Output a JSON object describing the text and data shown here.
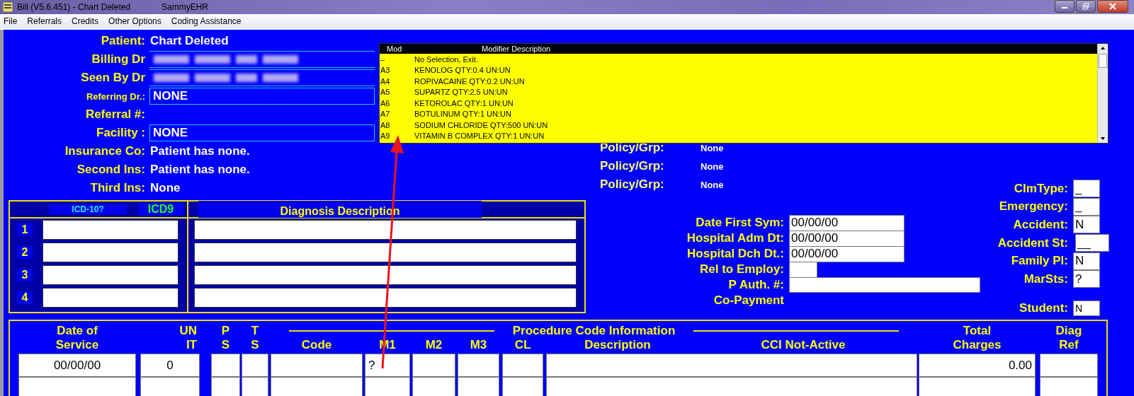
{
  "window": {
    "title": "Bill (V5.6.451) - Chart  Deleted",
    "app_name": "SammyEHR"
  },
  "menu": [
    "File",
    "Referrals",
    "Credits",
    "Other Options",
    "Coding Assistance"
  ],
  "patient_fields": [
    {
      "label": "Patient:",
      "kind": "text",
      "compact": false,
      "value": "Chart  Deleted"
    },
    {
      "label": "Billing Dr",
      "kind": "blurred",
      "compact": false
    },
    {
      "label": "Seen By Dr",
      "kind": "blurred",
      "compact": false
    },
    {
      "label": "Referring Dr.:",
      "kind": "field",
      "compact": true,
      "value": "NONE"
    },
    {
      "label": "Referral #:",
      "kind": "text",
      "compact": false
    },
    {
      "label": "Facility :",
      "kind": "field",
      "compact": false,
      "value": "NONE"
    },
    {
      "label": "Insurance Co:",
      "kind": "text",
      "compact": false,
      "value": "Patient has none."
    },
    {
      "label": "Second Ins:",
      "kind": "text",
      "compact": false,
      "value": "Patient has none."
    },
    {
      "label": "Third Ins:",
      "kind": "text",
      "compact": false,
      "value": "None"
    }
  ],
  "policies": [
    {
      "label": "Policy/Grp:",
      "value": "None"
    },
    {
      "label": "Policy/Grp:",
      "value": "None"
    },
    {
      "label": "Policy/Grp:",
      "value": "None"
    }
  ],
  "dates": [
    {
      "label": "Date First Sym:",
      "kind": "date",
      "value": "00/00/00"
    },
    {
      "label": "Hospital Adm Dt:",
      "kind": "date",
      "value": "00/00/00"
    },
    {
      "label": "Hospital Dch Dt.:",
      "kind": "date",
      "value": "00/00/00"
    },
    {
      "label": "Rel to Employ:",
      "kind": "short"
    },
    {
      "label": "P Auth. #:",
      "kind": "long"
    },
    {
      "label": "Co-Payment",
      "kind": "label"
    }
  ],
  "flags": [
    {
      "label": "ClmType:",
      "value": "_",
      "kind": "normal"
    },
    {
      "label": "Emergency:",
      "value": "_",
      "kind": "normal"
    },
    {
      "label": "Accident:",
      "value": "N",
      "kind": "normal"
    },
    {
      "label": "Accident St:",
      "value": "__",
      "kind": "wide"
    },
    {
      "label": "Family Pl:",
      "value": "N",
      "kind": "normal"
    },
    {
      "label": "MarSts:",
      "value": "?",
      "kind": "normal"
    }
  ],
  "student": {
    "label": "Student:",
    "value": "N"
  },
  "diagnosis": {
    "icd10_label": "ICD-10?",
    "icd9_label": "ICD9",
    "description_header": "Diagnosis Description",
    "rows": [
      {
        "number": "1"
      },
      {
        "number": "2"
      },
      {
        "number": "3"
      },
      {
        "number": "4"
      }
    ]
  },
  "procedures": {
    "section_title": "Procedure Code Information",
    "cci_label": "CCI Not-Active",
    "columns": [
      {
        "lines": [
          "Date of",
          "Service"
        ]
      },
      {
        "lines": [
          "UN",
          "IT"
        ]
      },
      {
        "lines": [
          "P",
          "S"
        ]
      },
      {
        "lines": [
          "T",
          "S"
        ]
      },
      {
        "lines": [
          "Code"
        ]
      },
      {
        "lines": [
          "M1"
        ]
      },
      {
        "lines": [
          "M2"
        ]
      },
      {
        "lines": [
          "M3"
        ]
      },
      {
        "lines": [
          "CL"
        ]
      },
      {
        "lines": [
          "Description"
        ]
      },
      {
        "lines": [
          "Total",
          "Charges"
        ]
      },
      {
        "lines": [
          "Diag",
          "Ref"
        ]
      }
    ],
    "rows": [
      {
        "date": "00/00/00",
        "unit": "0",
        "m1": "?",
        "total": "0.00"
      }
    ]
  },
  "modifier_popup": {
    "columns": [
      "Mod",
      "Modifier Description"
    ],
    "rows": [
      {
        "mod": "–",
        "description": "No Selection, Exit."
      },
      {
        "mod": "A3",
        "description": "KENOLOG QTY:0.4 UN:UN"
      },
      {
        "mod": "A4",
        "description": "ROPIVACAINE QTY:0.2 UN:UN"
      },
      {
        "mod": "A5",
        "description": "SUPARTZ QTY:2.5 UN:UN"
      },
      {
        "mod": "A6",
        "description": "KETOROLAC QTY:1 UN:UN"
      },
      {
        "mod": "A7",
        "description": "BOTULINUM QTY:1 UN:UN"
      },
      {
        "mod": "A8",
        "description": "SODIUM CHLORIDE QTY:500 UN:UN"
      },
      {
        "mod": "A9",
        "description": "VITAMIN B COMPLEX QTY:1 UN:UN"
      }
    ]
  }
}
